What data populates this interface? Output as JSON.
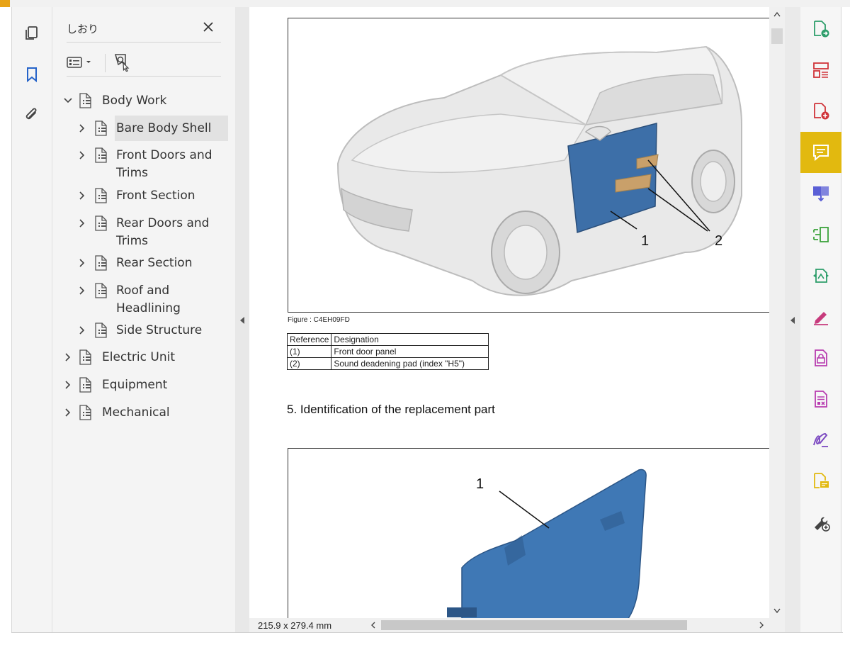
{
  "accent_color": "#e8a317",
  "left_rail": {
    "icons": [
      "pages-icon",
      "bookmark-icon",
      "attachment-icon"
    ],
    "active": "bookmark-icon"
  },
  "bookmarks_panel": {
    "title": "しおり",
    "close_icon": "close-icon",
    "toolbar": [
      "options-menu-icon",
      "find-bookmark-icon"
    ],
    "tree": [
      {
        "label": "Body Work",
        "expanded": true,
        "level": 0
      },
      {
        "label": "Bare Body Shell",
        "expanded": false,
        "level": 1,
        "selected": true
      },
      {
        "label": "Front Doors and",
        "label2": "Trims",
        "expanded": false,
        "level": 1
      },
      {
        "label": "Front Section",
        "expanded": false,
        "level": 1
      },
      {
        "label": "Rear Doors and",
        "label2": "Trims",
        "expanded": false,
        "level": 1
      },
      {
        "label": "Rear Section",
        "expanded": false,
        "level": 1
      },
      {
        "label": "Roof and",
        "label2": "Headlining",
        "expanded": false,
        "level": 1
      },
      {
        "label": "Side Structure",
        "expanded": false,
        "level": 1
      },
      {
        "label": "Electric Unit",
        "expanded": false,
        "level": 0
      },
      {
        "label": "Equipment",
        "expanded": false,
        "level": 0
      },
      {
        "label": "Mechanical",
        "expanded": false,
        "level": 0
      }
    ]
  },
  "document": {
    "figure1": {
      "callout_1": "1",
      "callout_2": "2",
      "door_color": "#3d6fa8",
      "pad_color": "#c9a06a"
    },
    "caption": "Figure : C4EH09FD",
    "table": {
      "headers": [
        "Reference",
        "Designation"
      ],
      "rows": [
        [
          "(1)",
          "Front door panel"
        ],
        [
          "(2)",
          "Sound deadening pad (index \"H5\")"
        ]
      ]
    },
    "section_heading": "5. Identification of the replacement part",
    "figure2": {
      "callout_1": "1",
      "panel_color": "#3f78b5"
    }
  },
  "status": {
    "page_size": "215.9 x 279.4 mm"
  },
  "tools_rail": {
    "tools": [
      {
        "name": "export-pdf-icon",
        "color": "#2e9e6b"
      },
      {
        "name": "organize-pages-icon",
        "color": "#d0343a"
      },
      {
        "name": "create-pdf-icon",
        "color": "#d0343a"
      },
      {
        "name": "comment-icon",
        "color": "#ffffff",
        "active": true
      },
      {
        "name": "combine-files-icon",
        "color": "#5a5fd6"
      },
      {
        "name": "scan-ocr-icon",
        "color": "#3ca33c"
      },
      {
        "name": "compare-files-icon",
        "color": "#2e9e6b"
      },
      {
        "name": "fill-sign-icon",
        "color": "#c73b7d"
      },
      {
        "name": "protect-icon",
        "color": "#b83db0"
      },
      {
        "name": "redact-icon",
        "color": "#b83db0"
      },
      {
        "name": "sign-icon",
        "color": "#7d4bc2"
      },
      {
        "name": "send-for-comments-icon",
        "color": "#e2b90f"
      },
      {
        "name": "more-tools-icon",
        "color": "#444444"
      }
    ]
  }
}
